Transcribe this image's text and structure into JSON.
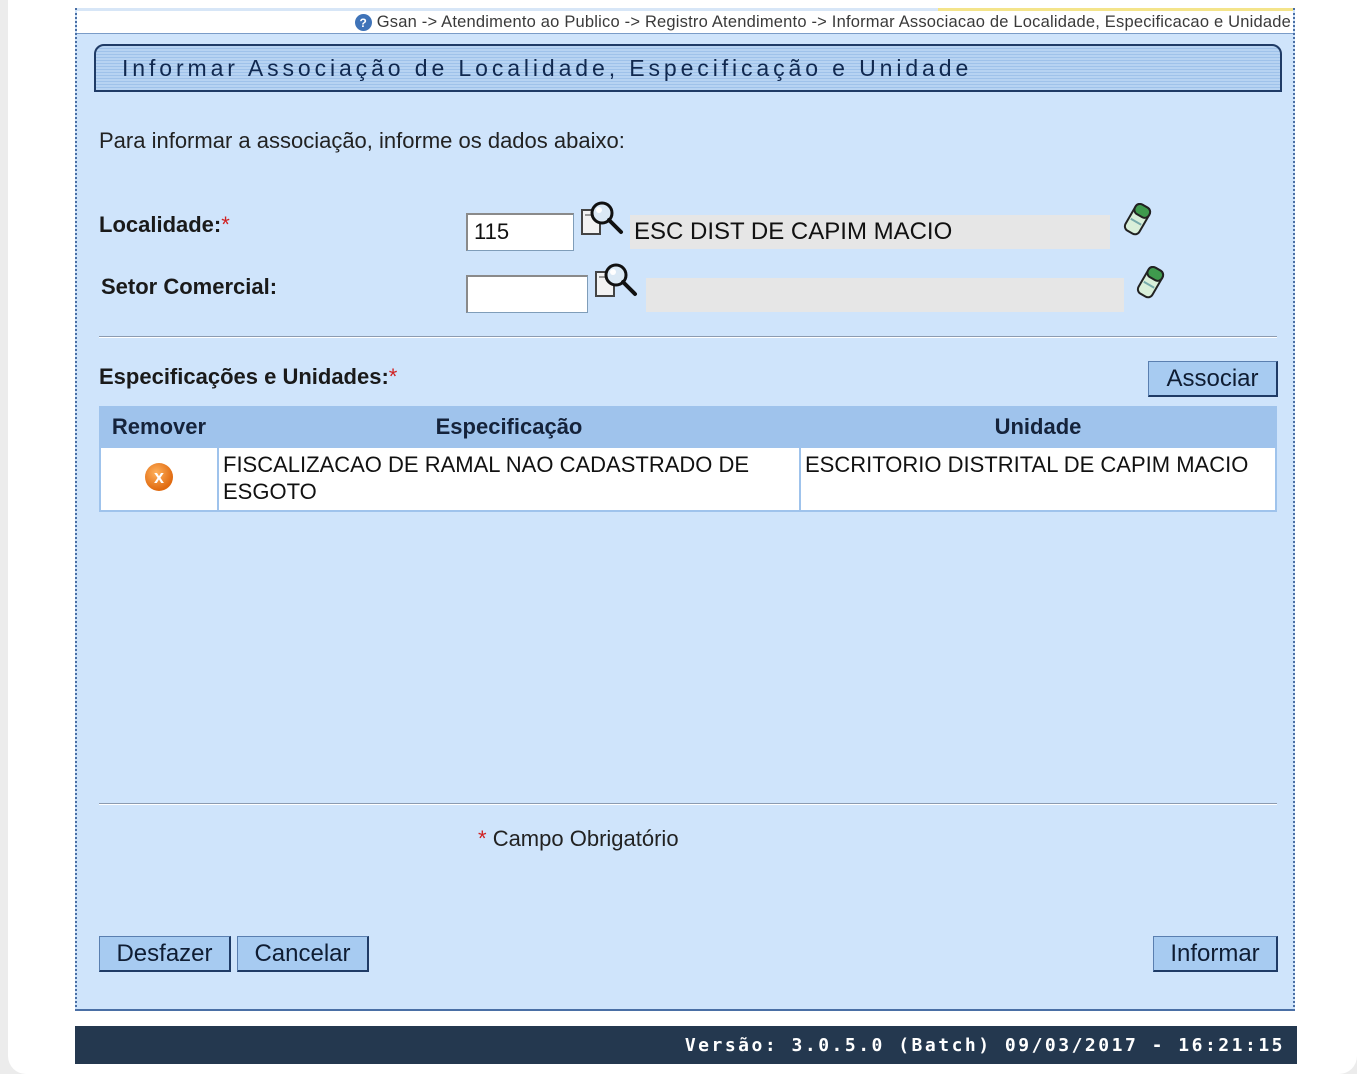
{
  "breadcrumb": "Gsan -> Atendimento ao Publico -> Registro Atendimento -> Informar Associacao de Localidade, Especificacao e Unidade",
  "page_title": "Informar Associação de Localidade, Especificação e Unidade",
  "intro_text": "Para informar a associação, informe os dados abaixo:",
  "localidade": {
    "label": "Localidade:",
    "required_mark": "*",
    "code": "115",
    "name": "ESC DIST DE CAPIM MACIO"
  },
  "setor_comercial": {
    "label": "Setor Comercial:",
    "code": "",
    "name": ""
  },
  "associacoes": {
    "label": "Especificações e Unidades:",
    "required_mark": "*",
    "associate_button": "Associar",
    "columns": [
      "Remover",
      "Especificação",
      "Unidade"
    ],
    "rows": [
      {
        "especificacao": "FISCALIZACAO DE RAMAL NAO CADASTRADO DE ESGOTO",
        "unidade": "ESCRITORIO DISTRITAL DE CAPIM MACIO"
      }
    ]
  },
  "required_note": {
    "mark": "*",
    "text": "Campo Obrigatório"
  },
  "buttons": {
    "undo": "Desfazer",
    "cancel": "Cancelar",
    "submit": "Informar"
  },
  "version": "Versão: 3.0.5.0 (Batch) 09/03/2017 - 16:21:15",
  "colors": {
    "panel_bg": "#cfe4fb",
    "button_bg": "#a7cbf1",
    "footer_bg": "#24384f",
    "required": "#d02020"
  }
}
